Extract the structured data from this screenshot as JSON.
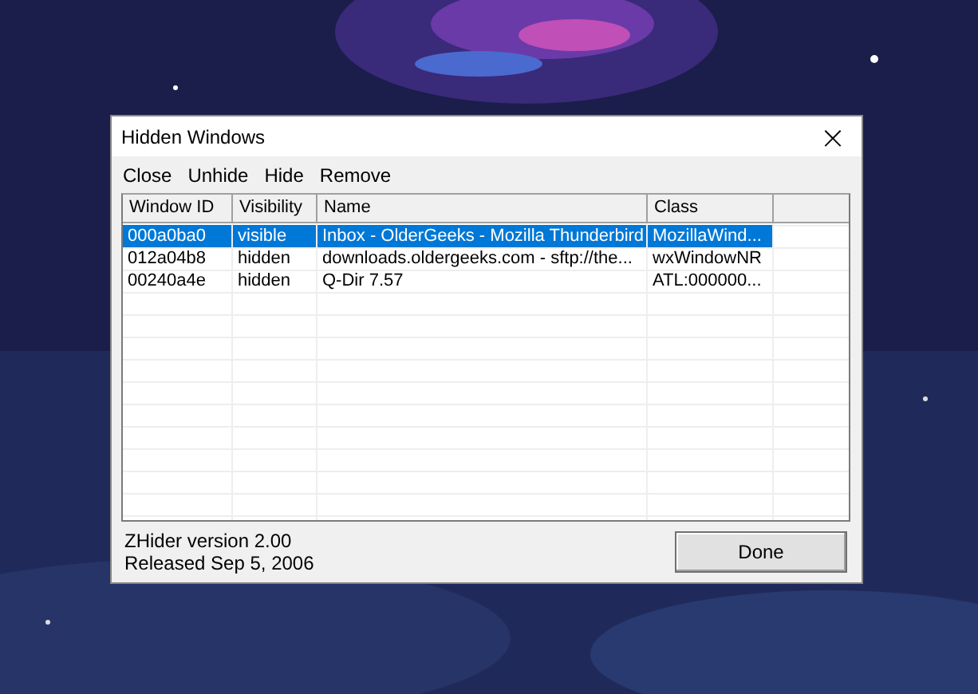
{
  "window": {
    "title": "Hidden Windows",
    "close": "×"
  },
  "menu": [
    {
      "label": "Close"
    },
    {
      "label": "Unhide"
    },
    {
      "label": "Hide"
    },
    {
      "label": "Remove"
    }
  ],
  "table": {
    "columns": [
      "Window ID",
      "Visibility",
      "Name",
      "Class"
    ],
    "rows": [
      {
        "cells": [
          "000a0ba0",
          "visible",
          "Inbox - OlderGeeks - Mozilla Thunderbird",
          "MozillaWind..."
        ],
        "selected": true
      },
      {
        "cells": [
          "012a04b8",
          "hidden",
          "downloads.oldergeeks.com - sftp://the...",
          "wxWindowNR"
        ],
        "selected": false
      },
      {
        "cells": [
          "00240a4e",
          "hidden",
          "Q-Dir 7.57",
          "ATL:000000..."
        ],
        "selected": false
      }
    ]
  },
  "footer": {
    "version": "ZHider version 2.00",
    "released": "Released Sep 5, 2006",
    "button": "Done"
  }
}
